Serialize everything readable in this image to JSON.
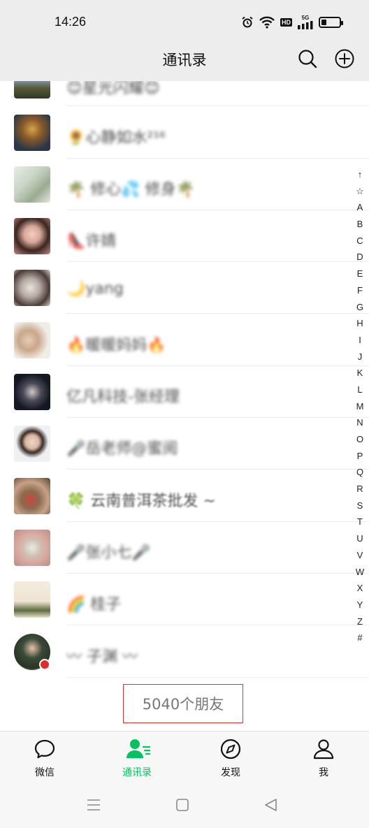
{
  "status": {
    "time": "14:26",
    "icons": [
      "alarm-icon",
      "wifi-icon",
      "hd-icon",
      "5g-signal-icon",
      "battery-icon"
    ],
    "hd": "HD",
    "network": "5G",
    "battery_level": 0.3
  },
  "header": {
    "title": "通讯录",
    "icons": [
      "search-icon",
      "add-circle-icon"
    ]
  },
  "contacts": [
    {
      "name": "😊星光闪耀😊"
    },
    {
      "name": "🌻心静如水²¹⁶"
    },
    {
      "name": "🌴 修心💦 修身🌴"
    },
    {
      "name": "👠许婧"
    },
    {
      "name": "🌙yang"
    },
    {
      "name": "🔥暖暖妈妈🔥"
    },
    {
      "name": "亿凡科技-张经理"
    },
    {
      "name": "🎤岳老师@蜜阅"
    },
    {
      "name": "🍀 云南普洱茶批发 ~"
    },
    {
      "name": "🎤张小七🎤"
    },
    {
      "name": "🌈 桂子"
    },
    {
      "name": "〰 子渊 〰"
    }
  ],
  "index_letters": [
    "↑",
    "☆",
    "A",
    "B",
    "C",
    "D",
    "E",
    "F",
    "G",
    "H",
    "I",
    "J",
    "K",
    "L",
    "M",
    "N",
    "O",
    "P",
    "Q",
    "R",
    "S",
    "T",
    "U",
    "V",
    "W",
    "X",
    "Y",
    "Z",
    "#"
  ],
  "friend_count": "5040个朋友",
  "tabs": [
    {
      "label": "微信",
      "icon": "chat-bubble-icon"
    },
    {
      "label": "通讯录",
      "icon": "contacts-icon",
      "active": true
    },
    {
      "label": "发现",
      "icon": "compass-icon"
    },
    {
      "label": "我",
      "icon": "person-icon"
    }
  ],
  "system_nav": [
    "menu-icon",
    "home-icon",
    "back-icon"
  ],
  "colors": {
    "accent": "#07c160",
    "highlight_box": "#e03030"
  }
}
